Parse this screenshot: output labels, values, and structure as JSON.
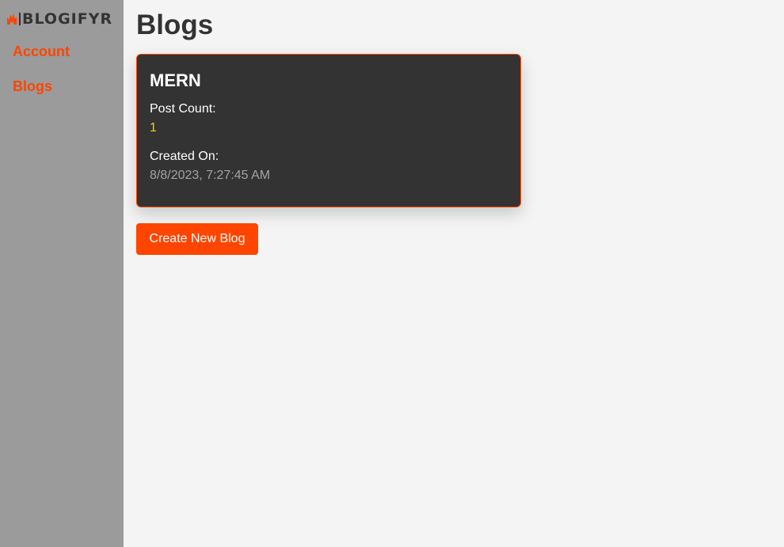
{
  "brand": {
    "logo_text": "BLOGIFYR",
    "accent_color": "#ff4500"
  },
  "sidebar": {
    "items": [
      {
        "label": "Account"
      },
      {
        "label": "Blogs"
      }
    ]
  },
  "main": {
    "title": "Blogs",
    "blogs": [
      {
        "name": "MERN",
        "post_count_label": "Post Count:",
        "post_count": "1",
        "created_label": "Created On:",
        "created_on": "8/8/2023, 7:27:45 AM"
      }
    ],
    "create_button_label": "Create New Blog"
  },
  "icons": {
    "logo": "flame-icon"
  }
}
